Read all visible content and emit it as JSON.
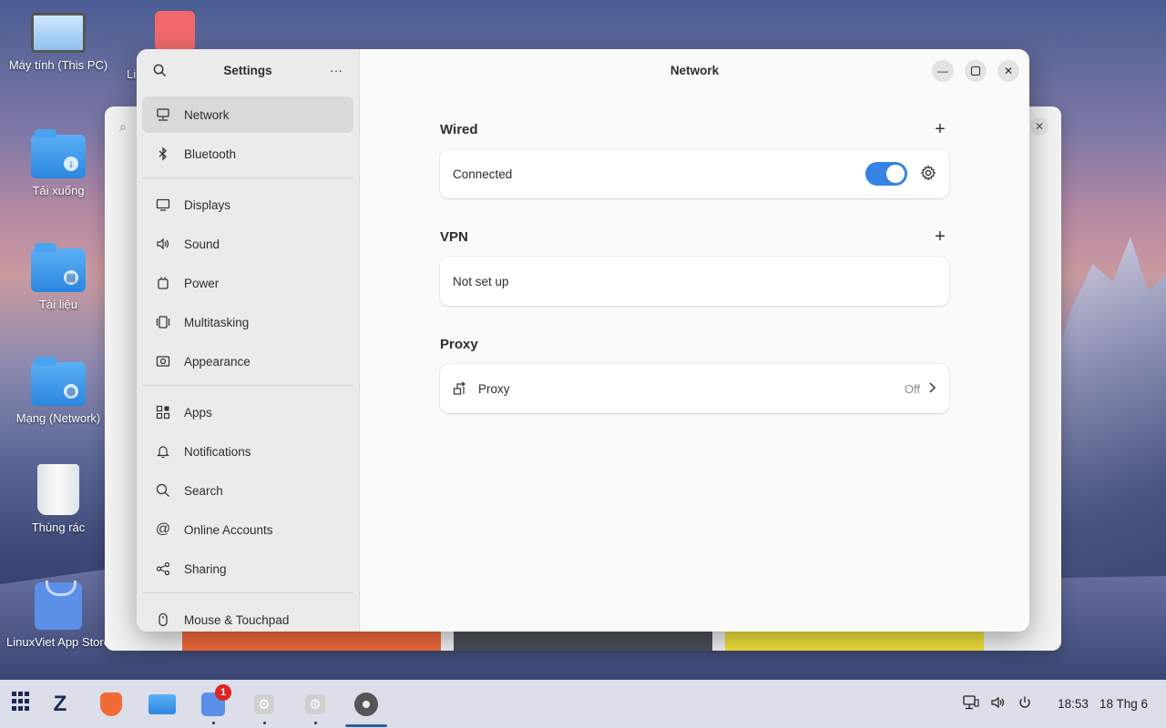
{
  "desktop": {
    "icons": [
      {
        "label": "Máy tính (This PC)",
        "icon": "computer-icon"
      },
      {
        "label": "Tải xuống",
        "icon": "download-folder-icon"
      },
      {
        "label": "Tài liệu",
        "icon": "documents-folder-icon"
      },
      {
        "label": "Mạng (Network)",
        "icon": "network-folder-icon"
      },
      {
        "label": "Thùng rác",
        "icon": "trash-icon"
      },
      {
        "label": "LinuxViet App Store",
        "icon": "app-store-icon"
      }
    ],
    "partial_label": "Li"
  },
  "settings": {
    "sidebar": {
      "title": "Settings",
      "items": [
        {
          "label": "Network",
          "icon": "network-icon"
        },
        {
          "label": "Bluetooth",
          "icon": "bluetooth-icon"
        },
        {
          "label": "Displays",
          "icon": "display-icon"
        },
        {
          "label": "Sound",
          "icon": "sound-icon"
        },
        {
          "label": "Power",
          "icon": "power-icon"
        },
        {
          "label": "Multitasking",
          "icon": "multitasking-icon"
        },
        {
          "label": "Appearance",
          "icon": "appearance-icon"
        },
        {
          "label": "Apps",
          "icon": "apps-icon"
        },
        {
          "label": "Notifications",
          "icon": "bell-icon"
        },
        {
          "label": "Search",
          "icon": "search-icon"
        },
        {
          "label": "Online Accounts",
          "icon": "at-icon"
        },
        {
          "label": "Sharing",
          "icon": "share-icon"
        },
        {
          "label": "Mouse & Touchpad",
          "icon": "mouse-icon"
        }
      ]
    },
    "page_title": "Network",
    "wired": {
      "title": "Wired",
      "status": "Connected",
      "enabled": true
    },
    "vpn": {
      "title": "VPN",
      "status": "Not set up"
    },
    "proxy": {
      "title": "Proxy",
      "label": "Proxy",
      "value": "Off"
    }
  },
  "taskbar": {
    "notification_count": "1",
    "time": "18:53",
    "date": "18 Thg 6"
  }
}
